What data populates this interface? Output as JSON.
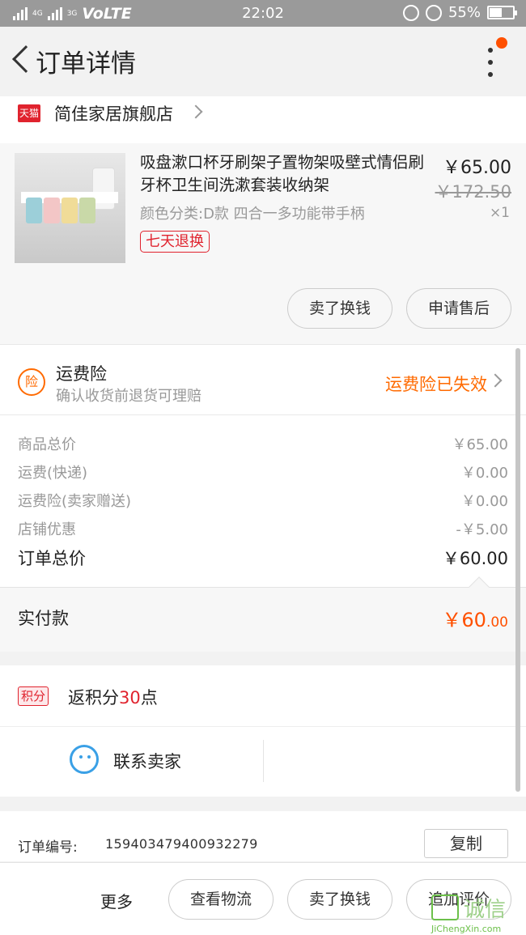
{
  "status_bar": {
    "net1": "4G",
    "net2": "3G",
    "carrier": "VoLTE",
    "time": "22:02",
    "battery": "55%",
    "battery_level": 0.55
  },
  "nav": {
    "title": "订单详情"
  },
  "shop": {
    "badge": "天猫",
    "name": "简佳家居旗舰店"
  },
  "product": {
    "title": "吸盘漱口杯牙刷架子置物架吸壁式情侣刷牙杯卫生间洗漱套装收纳架",
    "spec": "颜色分类:D款 四合一多功能带手柄",
    "badge": "七天退换",
    "price": "￥65.00",
    "original_price": "￥172.50",
    "quantity": "×1",
    "actions": {
      "sell": "卖了换钱",
      "after_sale": "申请售后"
    }
  },
  "insurance": {
    "icon_char": "险",
    "title": "运费险",
    "subtitle": "确认收货前退货可理赔",
    "status": "运费险已失效"
  },
  "price_detail": {
    "rows": [
      {
        "label": "商品总价",
        "value": "￥65.00"
      },
      {
        "label": "运费(快递)",
        "value": "￥0.00"
      },
      {
        "label": "运费险(卖家赠送)",
        "value": "￥0.00"
      },
      {
        "label": "店铺优惠",
        "value": "-￥5.00"
      }
    ],
    "total_label": "订单总价",
    "total_value": "￥60.00"
  },
  "paid": {
    "label": "实付款",
    "amount_main": "￥60",
    "amount_cents": ".00"
  },
  "points": {
    "badge": "积分",
    "text_prefix": "返积分",
    "number": "30",
    "text_suffix": "点"
  },
  "contact": {
    "label": "联系卖家"
  },
  "order": {
    "label": "订单编号:",
    "number": "159403479400932279",
    "copy": "复制"
  },
  "bottom_bar": {
    "more": "更多",
    "logistics": "查看物流",
    "sell": "卖了换钱",
    "review": "追加评价"
  },
  "watermark": {
    "text": "诚信",
    "sub": "JiChengXin.com"
  }
}
